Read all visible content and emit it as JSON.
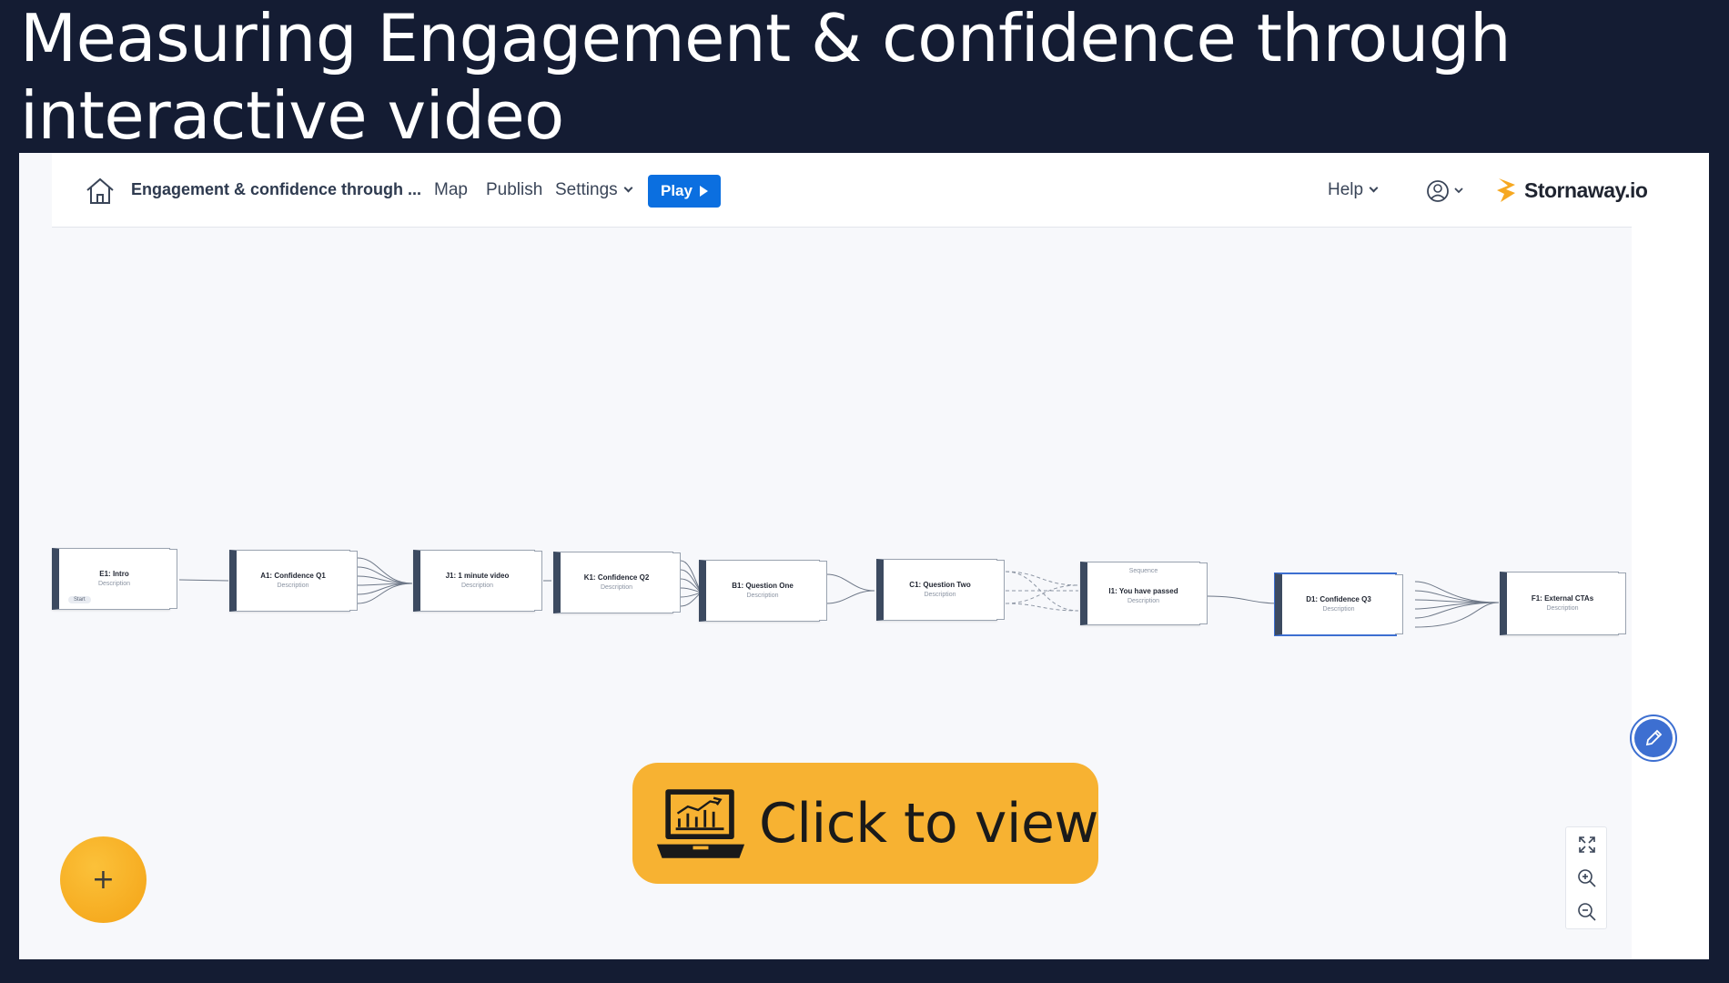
{
  "slide": {
    "title": "Measuring Engagement & confidence through interactive video"
  },
  "header": {
    "project_title": "Engagement & confidence through ...",
    "nav": [
      "Map",
      "Publish",
      "Settings"
    ],
    "play_label": "Play",
    "help_label": "Help",
    "logo_text": "Stornaway.io"
  },
  "nodes": [
    {
      "title": "E1: Intro",
      "description": "Description",
      "chip": "Start"
    },
    {
      "title": "A1: Confidence Q1",
      "description": "Description"
    },
    {
      "title": "J1: 1 minute video",
      "description": "Description"
    },
    {
      "title": "K1: Confidence Q2",
      "description": "Description"
    },
    {
      "title": "B1: Question One",
      "description": "Description"
    },
    {
      "title": "C1: Question Two",
      "description": "Description"
    },
    {
      "title": "I1: You have passed",
      "description": "Description",
      "pretitle": "Sequence"
    },
    {
      "title": "D1: Confidence Q3",
      "description": "Description"
    },
    {
      "title": "F1: External CTAs",
      "description": "Description"
    }
  ],
  "cta": {
    "label": "Click to view"
  },
  "icons": {
    "home": "home-icon",
    "user": "user-icon",
    "edit": "pencil-icon",
    "add": "plus-icon",
    "fit": "expand-icon",
    "zoom_in": "zoom-in-icon",
    "zoom_out": "zoom-out-icon",
    "cta": "laptop-chart-icon"
  },
  "colors": {
    "background": "#141c33",
    "accent": "#0b6fe0",
    "cta": "#f7b232",
    "fab": "#f4a316",
    "node_bar": "#3c4a60"
  }
}
